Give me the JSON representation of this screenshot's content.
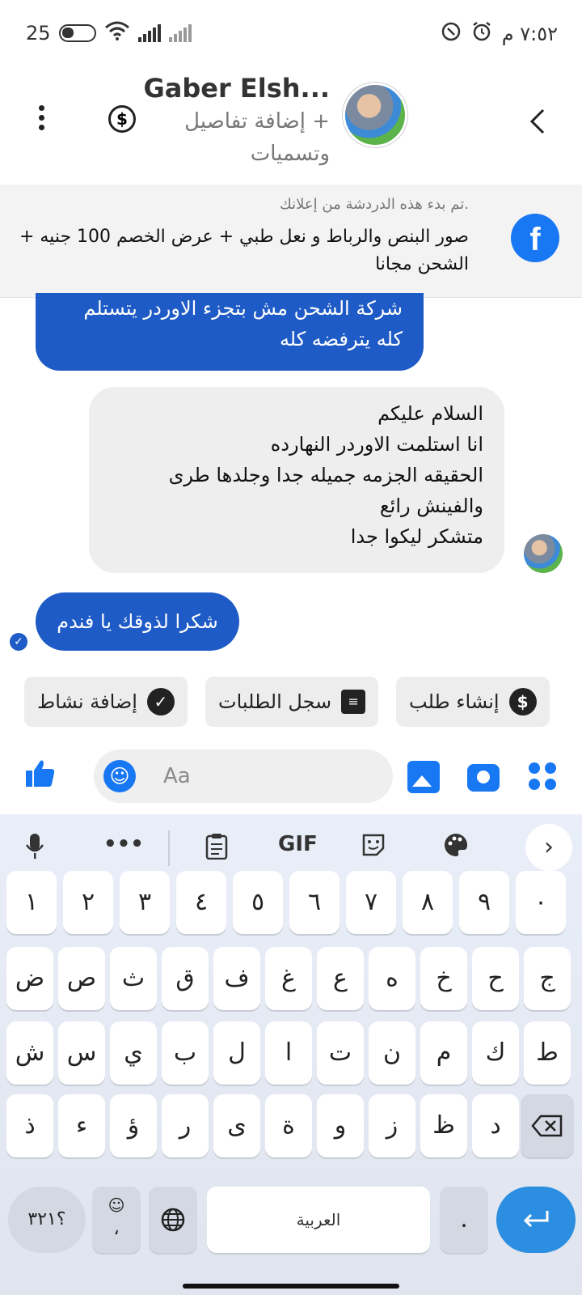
{
  "status_bar": {
    "battery": "25",
    "time": "٧:٥٢ م"
  },
  "header": {
    "contact_name": "Gaber Elsh...",
    "subtitle": "+ إضافة تفاصيل وتسميات"
  },
  "ad_banner": {
    "note": ".تم بدء هذه الدردشة من إعلانك",
    "text": "صور البنص والرباط  و نعل طبي + عرض الخصم 100 جنيه + الشحن مجانا"
  },
  "messages": [
    {
      "direction": "outgoing",
      "lines": [
        "شركة الشحن مش بتجزء الاوردر يتستلم",
        "كله يترفضه كله"
      ]
    },
    {
      "direction": "incoming",
      "lines": [
        "السلام عليكم",
        "انا استلمت الاوردر النهارده",
        "الحقيقه الجزمه جميله جدا وجلدها طرى",
        "والفينش رائع",
        "متشكر ليكوا جدا"
      ]
    },
    {
      "direction": "outgoing",
      "lines": [
        "شكرا لذوقك يا فندم"
      ]
    }
  ],
  "quick_actions": [
    {
      "label": "إنشاء طلب",
      "icon": "dollar-icon"
    },
    {
      "label": "سجل الطلبات",
      "icon": "receipt-icon"
    },
    {
      "label": "إضافة نشاط",
      "icon": "check-circle-icon"
    }
  ],
  "composer": {
    "placeholder": "Aa"
  },
  "keyboard": {
    "toolbar_gif": "GIF",
    "row1": [
      "١",
      "٢",
      "٣",
      "٤",
      "٥",
      "٦",
      "٧",
      "٨",
      "٩",
      "٠"
    ],
    "row2": [
      "ض",
      "ص",
      "ث",
      "ق",
      "ف",
      "غ",
      "ع",
      "ه",
      "خ",
      "ح",
      "ج"
    ],
    "row3": [
      "ش",
      "س",
      "ي",
      "ب",
      "ل",
      "ا",
      "ت",
      "ن",
      "م",
      "ك",
      "ط"
    ],
    "row4": [
      "ذ",
      "ء",
      "ؤ",
      "ر",
      "ى",
      "ة",
      "و",
      "ز",
      "ظ",
      "د"
    ],
    "symbols_key": "؟٣٢١",
    "space_label": "العربية",
    "period_key": ".",
    "comma_key": "،"
  },
  "colors": {
    "messenger_blue": "#1877f2",
    "outgoing_bubble": "#1e5bc6"
  }
}
